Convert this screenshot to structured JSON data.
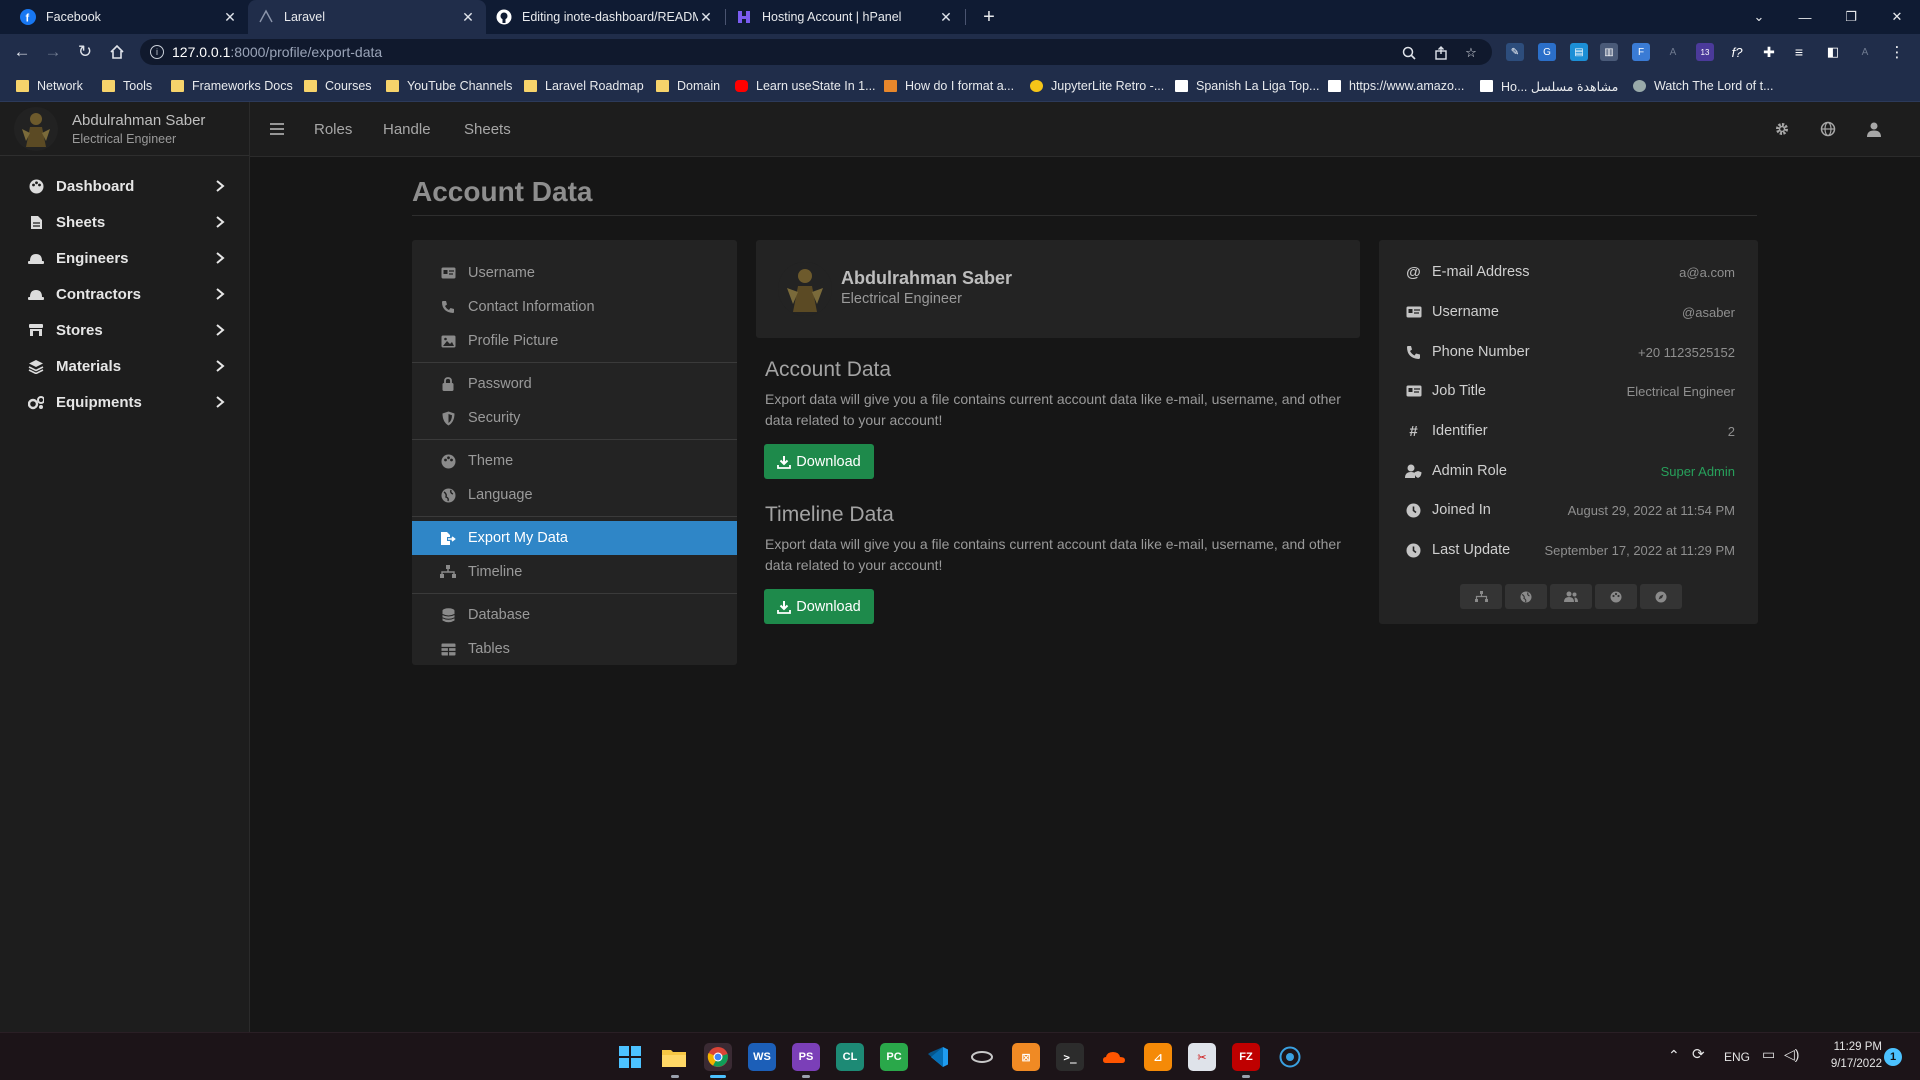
{
  "browser": {
    "tabs": [
      {
        "title": "Facebook",
        "icon": "facebook-icon",
        "active": false
      },
      {
        "title": "Laravel",
        "icon": "laravel-icon",
        "active": true
      },
      {
        "title": "Editing inote-dashboard/README",
        "icon": "github-icon",
        "active": false
      },
      {
        "title": "Hosting Account | hPanel",
        "icon": "hostinger-icon",
        "active": false
      }
    ],
    "url_host": "127.0.0.1",
    "url_path": ":8000/profile/export-data",
    "extension_badge": "13",
    "bookmarks": [
      {
        "label": "Network",
        "type": "folder"
      },
      {
        "label": "Tools",
        "type": "folder"
      },
      {
        "label": "Frameworks Docs",
        "type": "folder"
      },
      {
        "label": "Courses",
        "type": "folder"
      },
      {
        "label": "YouTube Channels",
        "type": "folder"
      },
      {
        "label": "Laravel Roadmap",
        "type": "folder"
      },
      {
        "label": "Domain",
        "type": "folder"
      },
      {
        "label": "Learn useState In 1...",
        "type": "youtube"
      },
      {
        "label": "How do I format a...",
        "type": "site"
      },
      {
        "label": "JupyterLite Retro -...",
        "type": "site"
      },
      {
        "label": "Spanish La Liga Top...",
        "type": "site"
      },
      {
        "label": "https://www.amazo...",
        "type": "amazon"
      },
      {
        "label": "Ho... مشاهدة مسلسل",
        "type": "site"
      },
      {
        "label": "Watch The Lord of t...",
        "type": "site"
      }
    ]
  },
  "user": {
    "name": "Abdulrahman Saber",
    "role": "Electrical Engineer"
  },
  "sidebar": {
    "items": [
      {
        "label": "Dashboard",
        "icon": "palette-icon"
      },
      {
        "label": "Sheets",
        "icon": "file-icon"
      },
      {
        "label": "Engineers",
        "icon": "hard-hat-icon"
      },
      {
        "label": "Contractors",
        "icon": "hard-hat-icon"
      },
      {
        "label": "Stores",
        "icon": "store-icon"
      },
      {
        "label": "Materials",
        "icon": "layers-icon"
      },
      {
        "label": "Equipments",
        "icon": "gears-icon"
      }
    ]
  },
  "topnav": {
    "links": [
      "Roles",
      "Handle",
      "Sheets"
    ],
    "icons": [
      "gear-icon",
      "globe-icon",
      "user-icon"
    ]
  },
  "page": {
    "title": "Account Data"
  },
  "settings_menu": {
    "groups": [
      [
        {
          "label": "Username",
          "icon": "id-card-icon"
        },
        {
          "label": "Contact Information",
          "icon": "phone-icon"
        },
        {
          "label": "Profile Picture",
          "icon": "image-icon"
        }
      ],
      [
        {
          "label": "Password",
          "icon": "lock-icon"
        },
        {
          "label": "Security",
          "icon": "shield-icon"
        }
      ],
      [
        {
          "label": "Theme",
          "icon": "palette-icon"
        },
        {
          "label": "Language",
          "icon": "globe-icon"
        }
      ],
      [
        {
          "label": "Export My Data",
          "icon": "file-export-icon",
          "active": true
        },
        {
          "label": "Timeline",
          "icon": "sitemap-icon"
        }
      ],
      [
        {
          "label": "Database",
          "icon": "database-icon"
        },
        {
          "label": "Tables",
          "icon": "table-icon"
        }
      ]
    ]
  },
  "export": {
    "account": {
      "heading": "Account Data",
      "text": "Export data will give you a file contains current account data like e-mail, username, and other data related to your account!",
      "button": "Download"
    },
    "timeline": {
      "heading": "Timeline Data",
      "text": "Export data will give you a file contains current account data like e-mail, username, and other data related to your account!",
      "button": "Download"
    }
  },
  "details": {
    "rows": [
      {
        "label": "E-mail Address",
        "value": "a@a.com",
        "icon": "at-icon"
      },
      {
        "label": "Username",
        "value": "@asaber",
        "icon": "id-card-icon"
      },
      {
        "label": "Phone Number",
        "value": "+20 1123525152",
        "icon": "phone-icon"
      },
      {
        "label": "Job Title",
        "value": "Electrical Engineer",
        "icon": "id-card-icon"
      },
      {
        "label": "Identifier",
        "value": "2",
        "icon": "hash-icon"
      },
      {
        "label": "Admin Role",
        "value": "Super Admin",
        "icon": "user-shield-icon",
        "value_color": "#27a05b"
      },
      {
        "label": "Joined In",
        "value": "August 29, 2022 at 11:54 PM",
        "icon": "clock-icon"
      },
      {
        "label": "Last Update",
        "value": "September 17, 2022 at 11:29 PM",
        "icon": "clock-icon"
      }
    ],
    "social_icons": [
      "sitemap-icon",
      "globe-icon",
      "users-icon",
      "palette-icon",
      "compass-icon"
    ]
  },
  "taskbar": {
    "language": "ENG",
    "time": "11:29 PM",
    "date": "9/17/2022",
    "notifications": "1"
  }
}
